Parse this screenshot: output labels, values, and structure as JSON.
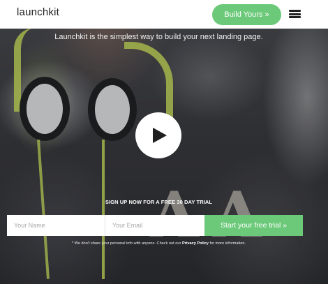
{
  "header": {
    "logo": "launchkit",
    "cta_label": "Build Yours »"
  },
  "hero": {
    "tagline": "Launchkit is the simplest way to build your next landing page.",
    "background_letters": "AA"
  },
  "signup": {
    "label": "SIGN UP NOW FOR A FREE 30 DAY TRIAL",
    "name_placeholder": "Your Name",
    "email_placeholder": "Your Email",
    "submit_label": "Start your free trial »"
  },
  "disclaimer": {
    "prefix": "* We don't share your personal info with anyone. Check out our ",
    "link": "Privacy Policy",
    "suffix": " for more information."
  },
  "colors": {
    "accent": "#6cc97a",
    "header_bg": "#ffffff",
    "text_dark": "#222222"
  },
  "icons": {
    "menu": "hamburger-icon",
    "play": "play-icon"
  }
}
